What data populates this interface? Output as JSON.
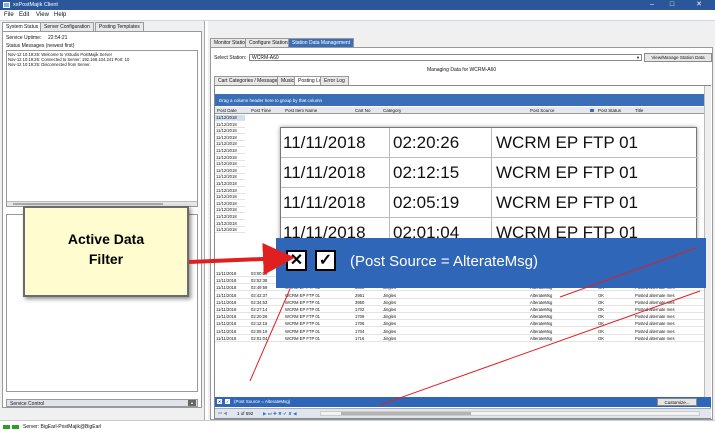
{
  "window": {
    "title": "xsPostMajik Client",
    "minimize": "–",
    "maximize": "□",
    "close": "✕"
  },
  "menu": [
    {
      "label": "File"
    },
    {
      "label": "Edit"
    },
    {
      "label": "View"
    },
    {
      "label": "Help"
    }
  ],
  "left_tabs": [
    {
      "label": "System Status"
    },
    {
      "label": "Server Configuration"
    },
    {
      "label": "Posting Templates"
    }
  ],
  "left": {
    "uptime_label": "Service Uptime:",
    "uptime_value": "22:54:21",
    "messages_label": "Status Messages (newest first)",
    "messages": [
      "Nov-12 10:19:25: Welcome to VStudio PostMajik Server",
      "Nov-12 10:19:25: Connected to Server: 192.168.104.241 Port: 10",
      "Nov-12 10:19:25: Disconnected from Server."
    ],
    "service_control_label": "Service Control"
  },
  "right_tabs": [
    {
      "label": "Monitor Station"
    },
    {
      "label": "Configure Stations"
    },
    {
      "label": "Station Data Management"
    }
  ],
  "station": {
    "select_label": "Select Station:",
    "select_value": "WCRM-A60",
    "view_manage_label": "View/Manage Station Data",
    "managing_text": "Managing Data for WCRM-A60"
  },
  "sub_tabs": [
    {
      "label": "Cart Categories / Messages"
    },
    {
      "label": "Music"
    },
    {
      "label": "Posting Log"
    },
    {
      "label": "Error Log"
    }
  ],
  "grid": {
    "group_hint": "Drag a column header here to group by that column",
    "columns": [
      "Post Date",
      "Post Time",
      "Post Item Name",
      "Cart No",
      "Category",
      "Post Source",
      "Post Status",
      "Title"
    ],
    "left_dates": [
      "11/12/2018",
      "11/12/2018",
      "11/12/2018",
      "11/12/2018",
      "11/12/2018",
      "11/12/2018",
      "11/12/2018",
      "11/12/2018",
      "11/12/2018",
      "11/12/2018",
      "11/12/2018",
      "11/12/2018",
      "11/12/2018",
      "11/12/2018",
      "11/12/2018",
      "11/12/2018",
      "11/12/2018",
      "11/12/2018"
    ],
    "rows": [
      [
        "11/11/2018",
        "03:00:09",
        "WCRM EP FTP 01",
        "1718",
        "Jingles",
        "AlterateMsg",
        "OK",
        "Posted alternate mes"
      ],
      [
        "11/11/2018",
        "02:52:38",
        "WCRM EP FTP 01",
        "2801",
        "Jingles",
        "AlterateMsg",
        "OK",
        "Posted alternate mes"
      ],
      [
        "11/11/2018",
        "02:49:59",
        "WCRM EP FTP 01",
        "3800",
        "Jingles",
        "AlterateMsg",
        "OK",
        "Posted alternate mes"
      ],
      [
        "11/11/2018",
        "02:42:37",
        "WCRM EP FTP 01",
        "2951",
        "Jingles",
        "AlterateMsg",
        "OK",
        "Posted alternate mes"
      ],
      [
        "11/11/2018",
        "02:34:53",
        "WCRM EP FTP 01",
        "3950",
        "Jingles",
        "AlterateMsg",
        "OK",
        "Posted alternate mes"
      ],
      [
        "11/11/2018",
        "02:27:14",
        "WCRM EP FTP 01",
        "1702",
        "Jingles",
        "AlterateMsg",
        "OK",
        "Posted alternate mes"
      ],
      [
        "11/11/2018",
        "02:20:26",
        "WCRM EP FTP 01",
        "1709",
        "Jingles",
        "AlterateMsg",
        "OK",
        "Posted alternate mes"
      ],
      [
        "11/11/2018",
        "02:12:15",
        "WCRM EP FTP 01",
        "1706",
        "Jingles",
        "AlterateMsg",
        "OK",
        "Posted alternate mes"
      ],
      [
        "11/11/2018",
        "02:05:19",
        "WCRM EP FTP 01",
        "1704",
        "Jingles",
        "AlterateMsg",
        "OK",
        "Posted alternate mes"
      ],
      [
        "11/11/2018",
        "02:01:04",
        "WCRM EP FTP 01",
        "1716",
        "Jingles",
        "AlterateMsg",
        "OK",
        "Posted alternate mes"
      ]
    ],
    "filter_text": "(Post Source = AlterateMsg)",
    "customize_label": "Customize...",
    "pager_text": "1 of 592"
  },
  "zoom": {
    "rows": [
      [
        "11/11/2018",
        "02:20:26",
        "WCRM EP FTP 01"
      ],
      [
        "11/11/2018",
        "02:12:15",
        "WCRM EP FTP 01"
      ],
      [
        "11/11/2018",
        "02:05:19",
        "WCRM EP FTP 01"
      ],
      [
        "11/11/2018",
        "02:01:04",
        "WCRM EP FTP 01"
      ]
    ],
    "filter_text": "(Post Source = AlterateMsg)"
  },
  "callout": {
    "line1": "Active Data",
    "line2": "Filter"
  },
  "status": {
    "text": "Server: BigEarl-PostMajik@BigEarl"
  },
  "colors": {
    "accent": "#2f66b8",
    "titlebar": "#2b579a",
    "arrow": "#e02020",
    "callout_bg": "#fffdd0"
  },
  "icons": [
    "app-icon",
    "close-filter-icon",
    "check-icon",
    "arrow-icon",
    "dropdown-icon"
  ]
}
